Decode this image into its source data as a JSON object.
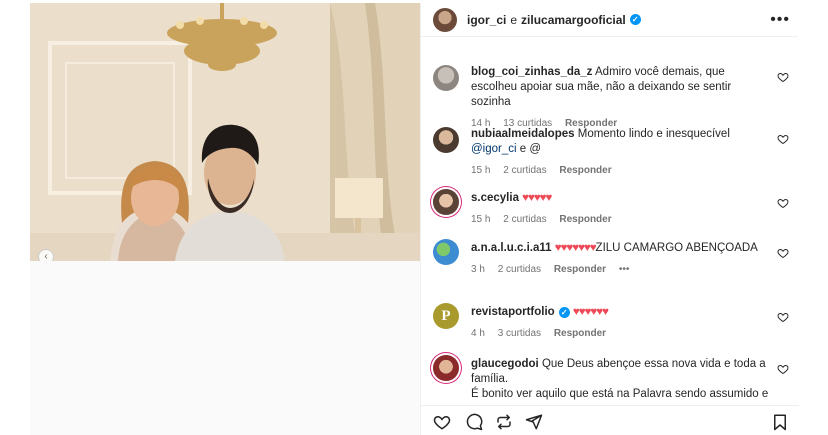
{
  "post": {
    "header": {
      "user1": "igor_ci",
      "joiner": "e",
      "user2": "zilucamargooficial"
    },
    "comments": [
      {
        "user": "blog_coi_zinhas_da_z",
        "text": "Admiro você demais, que escolheu apoiar sua mãe, não a deixando se sentir sozinha",
        "time": "14 h",
        "likes": "13 curtidas",
        "reply": "Responder"
      },
      {
        "user": "nubiaalmeidalopes",
        "text": "Momento lindo e inesquecível",
        "mention": "@igor_ci",
        "text_after": "e @",
        "time": "15 h",
        "likes": "2 curtidas",
        "reply": "Responder"
      },
      {
        "user": "s.cecylia",
        "hearts": "♥♥♥♥♥",
        "time": "15 h",
        "likes": "2 curtidas",
        "reply": "Responder"
      },
      {
        "user": "a.n.a.l.u.c.i.a11",
        "hearts": "♥♥♥♥♥♥♥",
        "text": "ZILU CAMARGO ABENÇOADA",
        "time": "3 h",
        "likes": "2 curtidas",
        "reply": "Responder",
        "more": "•••"
      },
      {
        "user": "revistaportfolio",
        "hearts": "♥♥♥♥♥♥",
        "time": "4 h",
        "likes": "3 curtidas",
        "reply": "Responder"
      },
      {
        "user": "glaucegodoi",
        "text": "Que Deus abençoe essa nova vida e toda a família.",
        "text2": "É bonito ver aquilo que está na Palavra sendo assumido e"
      }
    ]
  },
  "icons": [
    "more-options-icon",
    "like-icon",
    "comment-icon",
    "share-icon",
    "repost-icon",
    "save-icon",
    "verified-icon",
    "carousel-nav-icon"
  ],
  "colors": {
    "heart": "#ed4956",
    "verified": "#0095f6",
    "meta": "#737373",
    "mention": "#00376b"
  }
}
